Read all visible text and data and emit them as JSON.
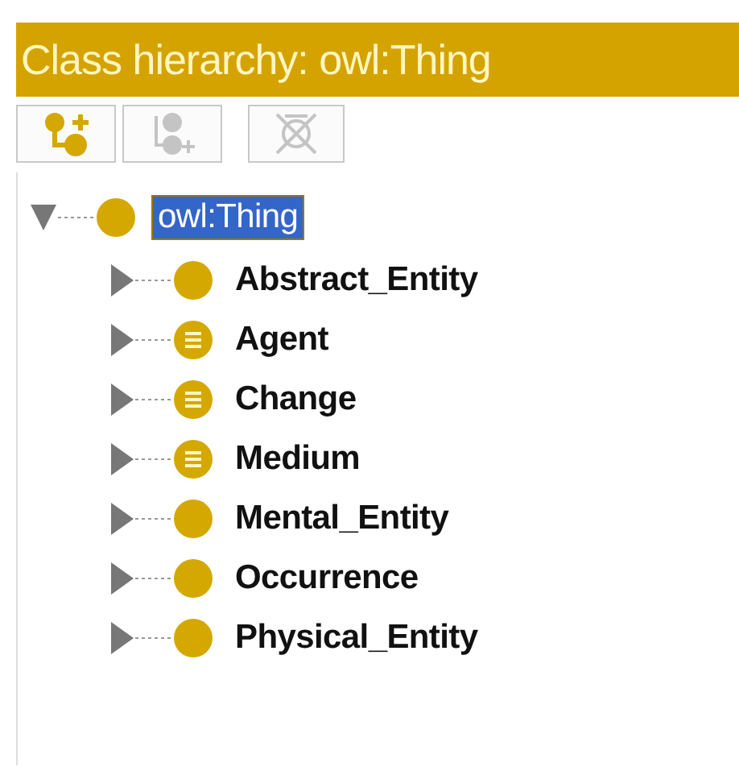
{
  "panel": {
    "title": "Class hierarchy: owl:Thing"
  },
  "toolbar": [
    {
      "kind": "add-subclass",
      "disabled": false
    },
    {
      "kind": "add-sibling",
      "disabled": true
    },
    {
      "kind": "delete",
      "disabled": true
    }
  ],
  "tree": [
    {
      "label": "owl:Thing",
      "kind": "primitive",
      "selected": true,
      "expanded": true,
      "children": [
        {
          "label": "Abstract_Entity",
          "kind": "primitive",
          "selected": false,
          "expanded": false
        },
        {
          "label": "Agent",
          "kind": "defined",
          "selected": false,
          "expanded": false
        },
        {
          "label": "Change",
          "kind": "defined",
          "selected": false,
          "expanded": false
        },
        {
          "label": "Medium",
          "kind": "defined",
          "selected": false,
          "expanded": false
        },
        {
          "label": "Mental_Entity",
          "kind": "primitive",
          "selected": false,
          "expanded": false
        },
        {
          "label": "Occurrence",
          "kind": "primitive",
          "selected": false,
          "expanded": false
        },
        {
          "label": "Physical_Entity",
          "kind": "primitive",
          "selected": false,
          "expanded": false
        }
      ]
    }
  ]
}
